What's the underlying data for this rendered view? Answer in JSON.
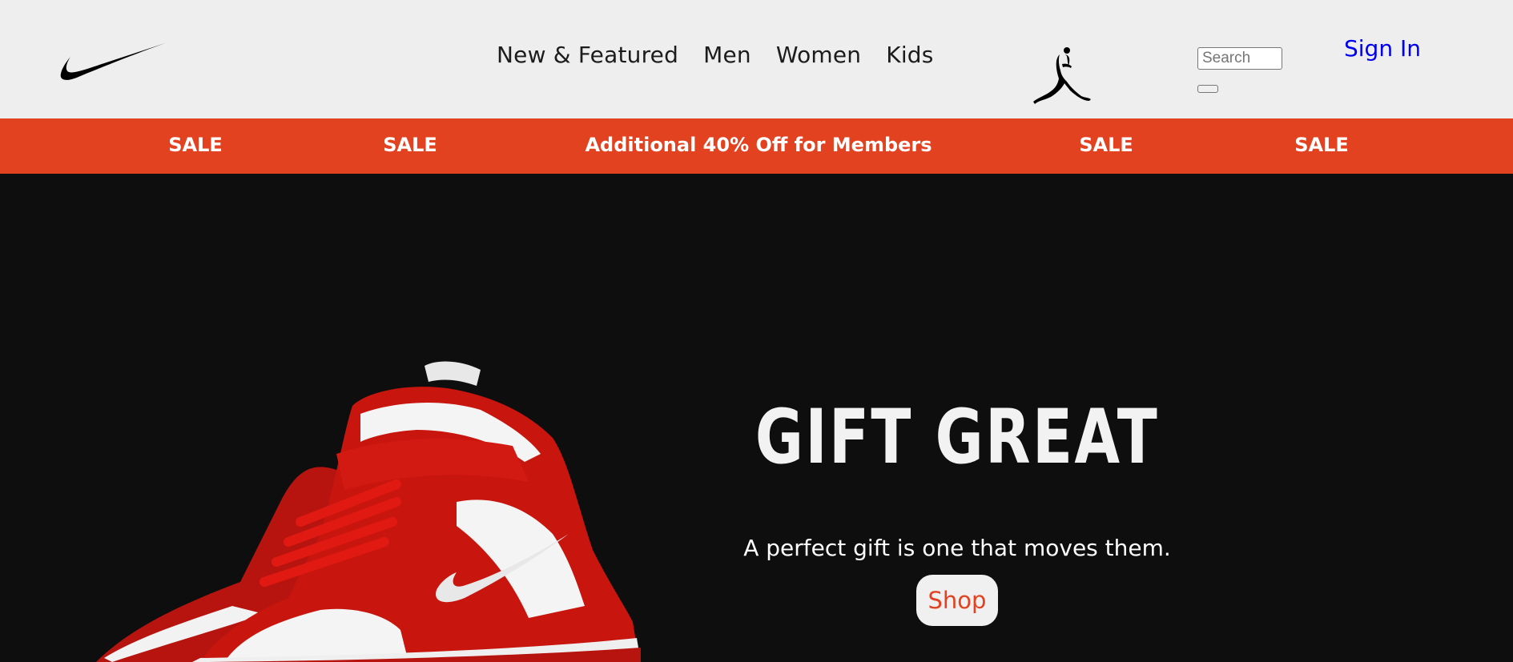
{
  "header": {
    "logo": "swoosh-logo-icon",
    "nav": [
      {
        "label": "New & Featured"
      },
      {
        "label": "Men"
      },
      {
        "label": "Women"
      },
      {
        "label": "Kids"
      }
    ],
    "brand_icon": "jumpman-icon",
    "search": {
      "placeholder": "Search",
      "value": ""
    },
    "sign_in": "Sign In"
  },
  "promo_bar": {
    "items": [
      "SALE",
      "SALE",
      "Additional 40% Off for Members",
      "SALE",
      "SALE"
    ],
    "color": "#e2421f"
  },
  "hero": {
    "image": "red-white-high-top-sneaker-image",
    "title": "GIFT GREAT",
    "subtitle": "A perfect gift is one that moves them.",
    "cta": "Shop",
    "cta_color": "#e2421f"
  }
}
